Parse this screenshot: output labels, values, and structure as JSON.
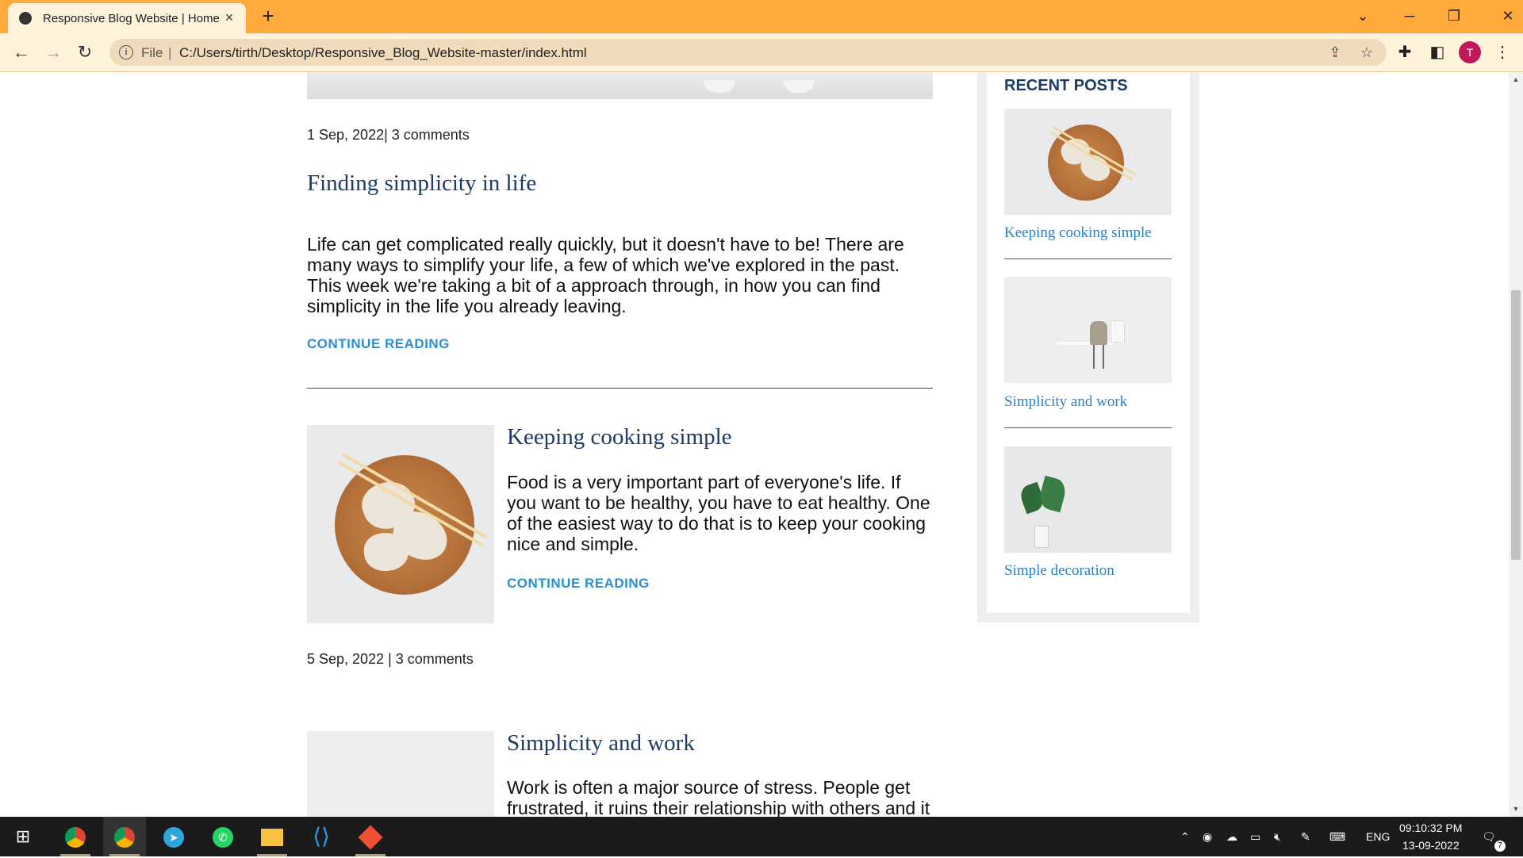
{
  "browser": {
    "tab_title": "Responsive Blog Website | Home",
    "url_scheme": "File",
    "url": "C:/Users/tirth/Desktop/Responsive_Blog_Website-master/index.html",
    "avatar_initial": "T"
  },
  "posts": [
    {
      "meta": "1 Sep, 2022| 3 comments",
      "title": "Finding simplicity in life",
      "excerpt": "Life can get complicated really quickly, but it doesn't have to be! There are many ways to simplify your life, a few of which we've explored in the past. This week we're taking a bit of a approach through, in how you can find simplicity in the life you already leaving.",
      "cta": "CONTINUE READING"
    },
    {
      "title": "Keeping cooking simple",
      "excerpt": "Food is a very important part of everyone's life. If you want to be healthy, you have to eat healthy. One of the easiest way to do that is to keep your cooking nice and simple.",
      "cta": "CONTINUE READING",
      "meta": "5 Sep, 2022 | 3 comments"
    },
    {
      "title": "Simplicity and work",
      "excerpt": "Work is often a major source of stress. People get frustrated, it ruins their relationship with others and it"
    }
  ],
  "sidebar": {
    "heading": "RECENT POSTS",
    "items": [
      {
        "label": "Keeping cooking simple"
      },
      {
        "label": "Simplicity and work"
      },
      {
        "label": "Simple decoration"
      }
    ]
  },
  "taskbar": {
    "language": "ENG",
    "time": "09:10:32 PM",
    "date": "13-09-2022",
    "notification_count": "7"
  },
  "colors": {
    "tab_bar": "#ffaa3b",
    "title": "#1d3b66",
    "link": "#2a8fd4"
  }
}
